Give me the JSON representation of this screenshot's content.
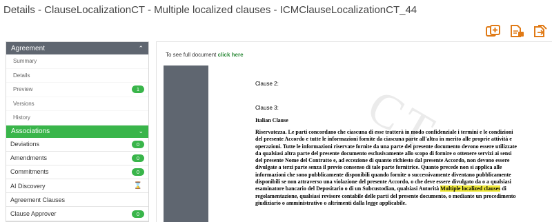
{
  "page": {
    "title": "Details - ClauseLocalizationCT - Multiple localized clauses - ICMClauseLocalizationCT_44"
  },
  "actions": {
    "icons": [
      "add-document-icon",
      "edit-document-icon",
      "export-document-icon"
    ],
    "accent_color": "#e07a16"
  },
  "sidebar": {
    "agreement": {
      "label": "Agreement",
      "items": [
        {
          "label": "Summary"
        },
        {
          "label": "Details"
        },
        {
          "label": "Preview",
          "badge": "1"
        },
        {
          "label": "Versions"
        },
        {
          "label": "History"
        }
      ]
    },
    "associations": {
      "label": "Associations",
      "items": [
        {
          "label": "Deviations",
          "badge": "0"
        },
        {
          "label": "Amendments",
          "badge": "0"
        },
        {
          "label": "Commitments",
          "badge": "0"
        },
        {
          "label": "AI Discovery",
          "icon": "hourglass-icon"
        },
        {
          "label": "Agreement Clauses"
        },
        {
          "label": "Clause Approver",
          "badge": "0"
        }
      ]
    },
    "colors": {
      "section_dark": "#5f6670",
      "section_green": "#39b54a",
      "badge": "#39b54a"
    }
  },
  "content": {
    "full_doc_prefix": "To see full document",
    "full_doc_link": "click here",
    "document": {
      "watermark": "CT",
      "clause2": "Clause 2:",
      "clause3": "Clause 3:",
      "italian_heading": "Italian Clause",
      "paragraph_before": "Riservatezza. Le parti  concordano che ciascuna di esse tratterà in modo confidenziale i termini e le condizioni del presente Accordo e tutte le informazioni fornite da ciascuna parte all'altra in merito alle proprie attività e operazioni. Tutte le informazioni riservate fornite da una parte del presente documento devono essere utilizzate da qualsiasi altra parte del presente documento esclusivamente allo scopo di fornire o ottenere servizi ai sensi del presente Nome del Contratto e, ad eccezione di quanto richiesto dal presente Accordo, non devono essere divulgate a terzi parte senza il previo consenso di tale parte fornitrice. Quanto precede non si applica alle informazioni che sono pubblicamente disponibili quando fornite o successivamente diventano pubblicamente disponibili se non attraverso una violazione del presente Accordo, o che deve essere divulgato da o a qualsiasi esaminatore bancario del Depositario o di un Subcustodian, qualsiasi Autorità",
      "highlight": "Multiple localized clauses",
      "paragraph_after": " di regolamentazione, qualsiasi revisore contabile delle parti del presente documento, o mediante un procedimento giudiziario o amministrativo o altrimenti dalla legge applicabile."
    }
  }
}
